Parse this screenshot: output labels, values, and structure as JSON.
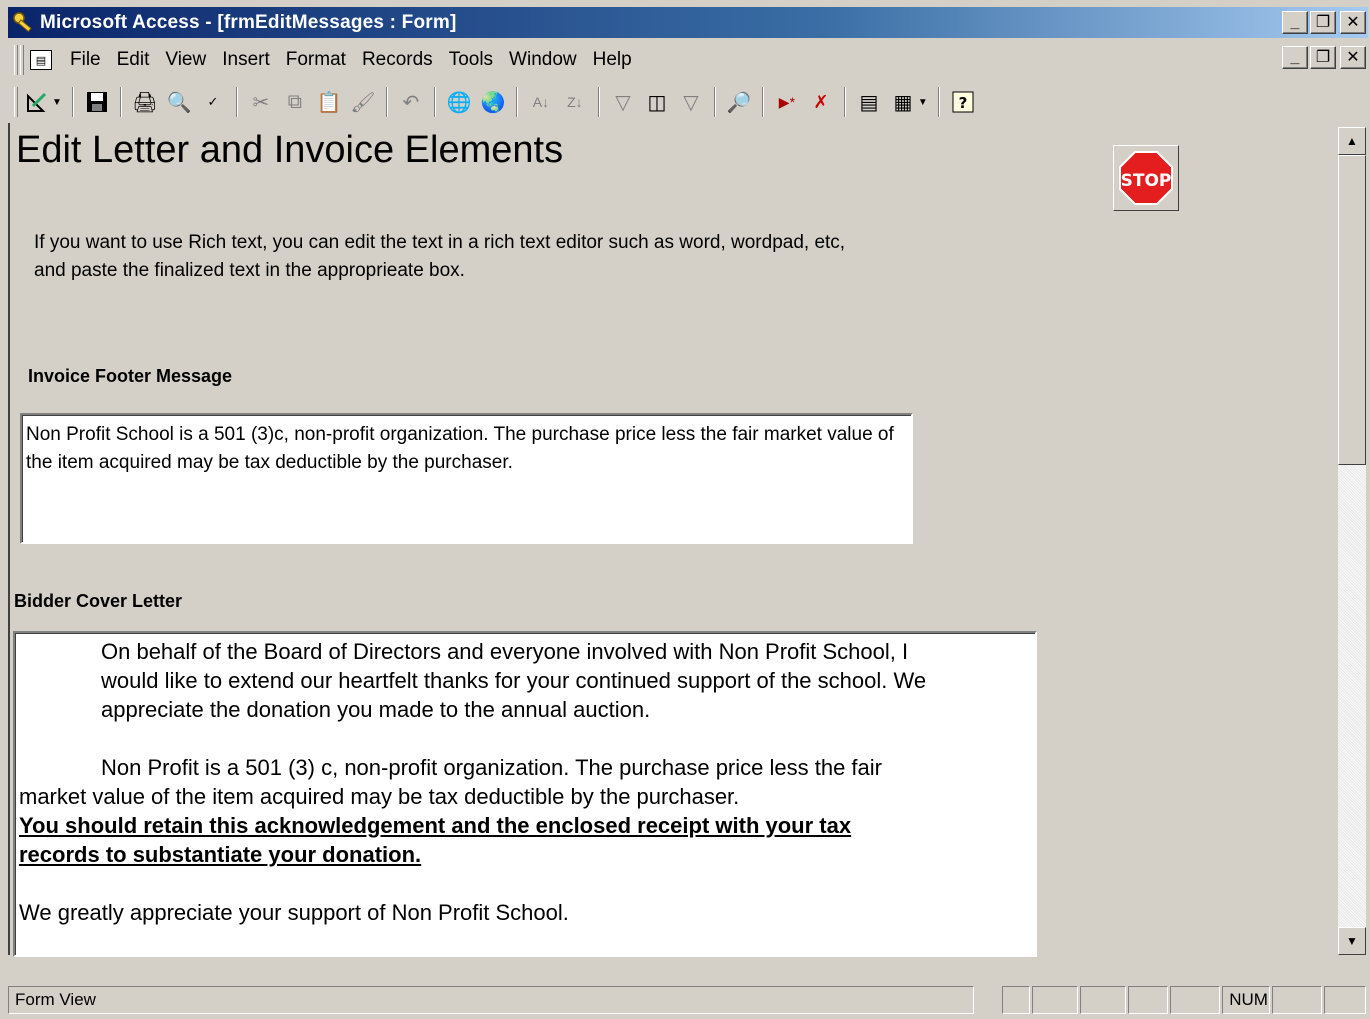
{
  "window": {
    "title": "Microsoft Access - [frmEditMessages : Form]",
    "controls": [
      "_",
      "❐",
      "✕"
    ]
  },
  "menu": {
    "items": [
      "File",
      "Edit",
      "View",
      "Insert",
      "Format",
      "Records",
      "Tools",
      "Window",
      "Help"
    ]
  },
  "toolbar": {
    "icons": [
      "design-view-icon",
      "save-icon",
      "print-icon",
      "print-preview-icon",
      "spelling-icon",
      "cut-icon",
      "copy-icon",
      "paste-icon",
      "format-painter-icon",
      "undo-icon",
      "hyperlink-icon",
      "web-toolbar-icon",
      "sort-ascending-icon",
      "sort-descending-icon",
      "filter-by-selection-icon",
      "filter-by-form-icon",
      "apply-filter-icon",
      "find-icon",
      "new-record-icon",
      "delete-record-icon",
      "database-window-icon",
      "new-object-icon",
      "help-icon"
    ]
  },
  "form": {
    "heading": "Edit Letter and Invoice Elements",
    "stop_label": "STOP",
    "intro": "If you want to use Rich text,  you can edit the text in a rich text editor such as word, wordpad, etc, and paste the finalized text in the approprieate box.",
    "invoice_footer": {
      "label": "Invoice Footer Message",
      "value": "Non Profit School is a 501 (3)c, non-profit organization.  The purchase price less the fair market value of the item acquired may be tax deductible by the purchaser."
    },
    "cover_letter": {
      "label": "Bidder Cover Letter",
      "para1": "On behalf of the Board of Directors and everyone involved with Non Profit School, I would like to extend our heartfelt thanks for your continued support of the school.  We appreciate the donation you made to the annual auction.",
      "para2": "Non Profit is a 501 (3) c, non-profit organization.  The purchase price less the fair market value of the item acquired may be tax deductible by the purchaser.",
      "para2_bold": "You should retain this acknowledgement and the enclosed receipt with your tax records to substantiate your donation.",
      "para3": "We greatly appreciate your support of Non Profit School."
    }
  },
  "status": {
    "mode": "Form View",
    "num": "NUM"
  }
}
